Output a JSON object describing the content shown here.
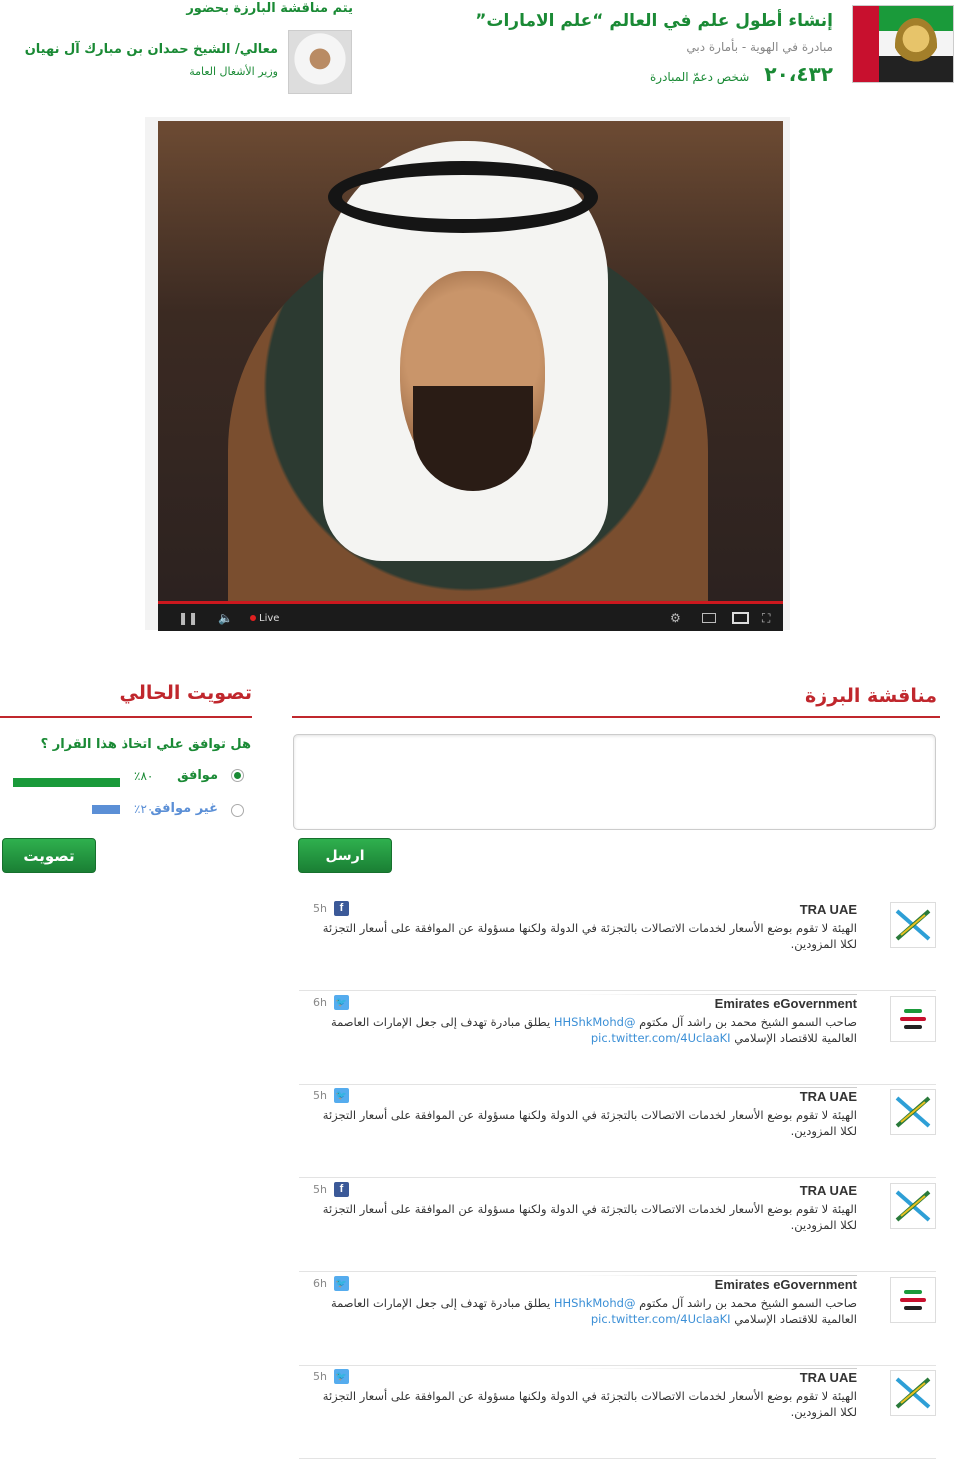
{
  "initiative": {
    "title": "إنشاء أطول علم في العالم “علم الامارات”",
    "subtitle": "مبادرة في الهوية  -  بأمارة دبي",
    "support_count": "٢٠،٤٣٢",
    "support_label": "شخص دعمّ المبادرة"
  },
  "guest": {
    "intro": "يتم مناقشة البارزة بحضور",
    "name": "معالي/ الشيخ حمدان بن مبارك آل نهيان",
    "role": "وزير الأشغال العامة"
  },
  "video": {
    "live_label": "Live"
  },
  "vote": {
    "title": "تصويت الحالي",
    "question": "هل توافق علي اتخاذ هذا القرار ؟",
    "options": [
      {
        "label": "موافق",
        "percent_text": "٨٠٪",
        "percent": 80,
        "color": "#1a9a3a",
        "selected": true
      },
      {
        "label": "غير موافق",
        "percent_text": "٢٠٪",
        "percent": 20,
        "color": "#5b8fd6",
        "selected": false
      }
    ],
    "button_label": "تصويت"
  },
  "discussion": {
    "title": "مناقشة البرزة",
    "comment_placeholder": "",
    "send_label": "ارسل",
    "feed": [
      {
        "name": "TRA UAE",
        "network": "facebook",
        "time": "5h",
        "text": "الهيئة لا تقوم بوضع الأسعار لخدمات الاتصالات بالتجزئة في الدولة ولكنها مسؤولة عن الموافقة على أسعار التجزئة لكلا المزودين.",
        "mention": "",
        "link": ""
      },
      {
        "name": "Emirates eGovernment",
        "network": "twitter",
        "time": "6h",
        "text_before": "صاحب السمو الشيخ محمد بن راشد آل مكتوم",
        "mention": "@HHShkMohd",
        "text": "يطلق مبادرة تهدف إلى جعل الإمارات العاصمة العالمية للاقتصاد الإسلامي",
        "link": "pic.twitter.com/4UclaaKI"
      },
      {
        "name": "TRA UAE",
        "network": "twitter",
        "time": "5h",
        "text": "الهيئة لا تقوم بوضع الأسعار لخدمات الاتصالات بالتجزئة في الدولة ولكنها مسؤولة عن الموافقة على أسعار التجزئة لكلا المزودين.",
        "mention": "",
        "link": ""
      },
      {
        "name": "TRA UAE",
        "network": "facebook",
        "time": "5h",
        "text": "الهيئة لا تقوم بوضع الأسعار لخدمات الاتصالات بالتجزئة في الدولة ولكنها مسؤولة عن الموافقة على أسعار التجزئة لكلا المزودين.",
        "mention": "",
        "link": ""
      },
      {
        "name": "Emirates eGovernment",
        "network": "twitter",
        "time": "6h",
        "text_before": "صاحب السمو الشيخ محمد بن راشد آل مكتوم",
        "mention": "@HHShkMohd",
        "text": "يطلق مبادرة تهدف إلى جعل الإمارات العاصمة العالمية للاقتصاد الإسلامي",
        "link": "pic.twitter.com/4UclaaKI"
      },
      {
        "name": "TRA UAE",
        "network": "twitter",
        "time": "5h",
        "text": "الهيئة لا تقوم بوضع الأسعار لخدمات الاتصالات بالتجزئة في الدولة ولكنها مسؤولة عن الموافقة على أسعار التجزئة لكلا المزودين.",
        "mention": "",
        "link": ""
      }
    ]
  }
}
